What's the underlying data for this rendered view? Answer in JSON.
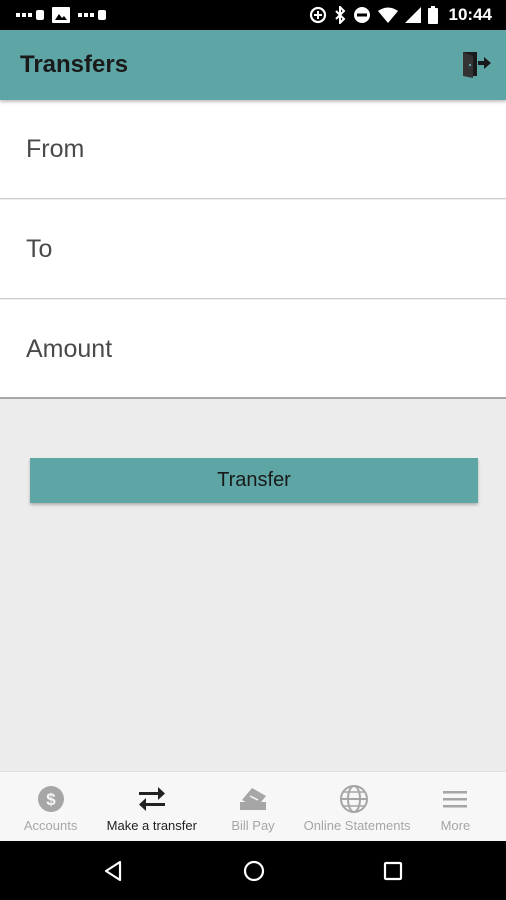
{
  "status_bar": {
    "time": "10:44",
    "icons": [
      "signal-dots-icon",
      "image-icon",
      "signal-dots-icon",
      "data-saver-icon",
      "bluetooth-icon",
      "do-not-disturb-icon",
      "wifi-icon",
      "cell-signal-icon",
      "battery-icon"
    ]
  },
  "app_bar": {
    "title": "Transfers",
    "logout_icon": "logout-door-icon"
  },
  "form": {
    "from_placeholder": "From",
    "to_placeholder": "To",
    "amount_placeholder": "Amount"
  },
  "transfer_button": {
    "label": "Transfer"
  },
  "bottom_nav": {
    "items": [
      {
        "label": "Accounts",
        "icon": "dollar-circle-icon",
        "active": false
      },
      {
        "label": "Make a transfer",
        "icon": "swap-arrows-icon",
        "active": true
      },
      {
        "label": "Bill Pay",
        "icon": "bill-pay-icon",
        "active": false
      },
      {
        "label": "Online Statements",
        "icon": "globe-icon",
        "active": false
      },
      {
        "label": "More",
        "icon": "menu-icon",
        "active": false
      }
    ]
  },
  "colors": {
    "accent": "#5ea5a5",
    "background": "#ececec",
    "inactive_nav": "#a6a6a6",
    "active_nav": "#222222"
  }
}
